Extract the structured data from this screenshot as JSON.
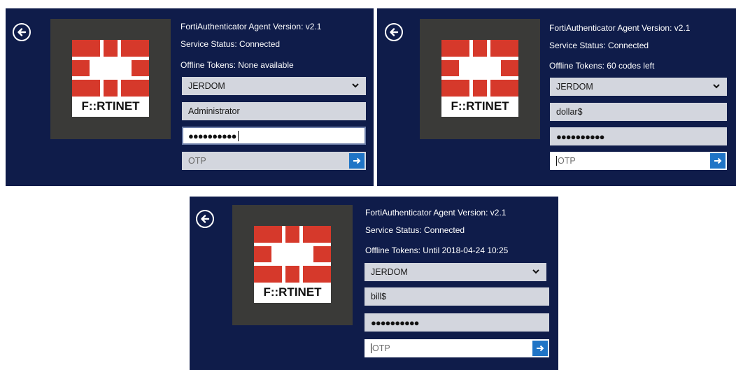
{
  "colors": {
    "panel_bg": "#0f1c4a",
    "logo_tile": "#3a3a38",
    "fortinet_red": "#d6392b",
    "field_bg": "#d3d6de",
    "submit_blue": "#1f74c6"
  },
  "panels": [
    {
      "version": "FortiAuthenticator Agent Version: v2.1",
      "status": "Service Status: Connected",
      "tokens": "Offline Tokens: None available",
      "domain": "JERDOM",
      "username": "Administrator",
      "password_mask": "●●●●●●●●●●",
      "otp_placeholder": "OTP",
      "logo_text": "F::RTINET"
    },
    {
      "version": "FortiAuthenticator Agent Version: v2.1",
      "status": "Service Status: Connected",
      "tokens": "Offline Tokens: 60 codes left",
      "domain": "JERDOM",
      "username": "dollar$",
      "password_mask": "●●●●●●●●●●",
      "otp_placeholder": "OTP",
      "logo_text": "F::RTINET"
    },
    {
      "version": "FortiAuthenticator Agent Version: v2.1",
      "status": "Service Status: Connected",
      "tokens": "Offline Tokens: Until 2018-04-24 10:25",
      "domain": "JERDOM",
      "username": "bill$",
      "password_mask": "●●●●●●●●●●",
      "otp_placeholder": "OTP",
      "logo_text": "F::RTINET"
    }
  ]
}
